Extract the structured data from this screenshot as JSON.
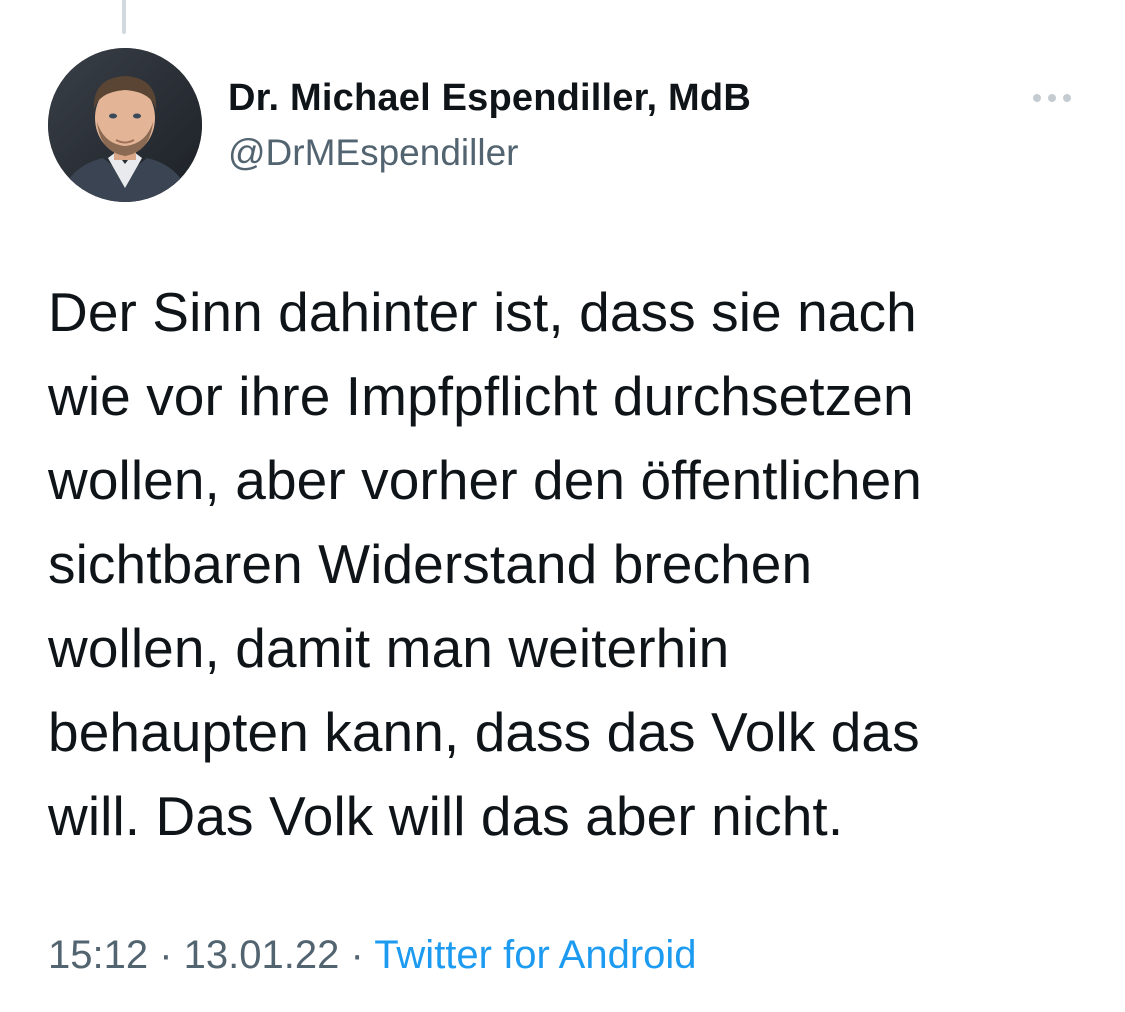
{
  "tweet": {
    "author": {
      "display_name": "Dr. Michael Espendiller, MdB",
      "handle": "@DrMEspendiller",
      "avatar_icon": "person-portrait"
    },
    "more_icon": "more-horizontal-icon",
    "text": "Der Sinn dahinter ist, dass sie nach\nwie vor ihre Impfpflicht durchsetzen\nwollen, aber vorher den öffentlichen\nsichtbaren Widerstand brechen\nwollen, damit man weiterhin\nbehaupten kann, dass das Volk das\nwill. Das Volk will das aber nicht.",
    "meta": {
      "time": "15:12",
      "separator": " · ",
      "date": "13.01.22",
      "source": "Twitter for Android"
    }
  },
  "colors": {
    "text_primary": "#0f1419",
    "text_secondary": "#536471",
    "link": "#1d9bf0",
    "thread_line": "#cfd9de"
  }
}
